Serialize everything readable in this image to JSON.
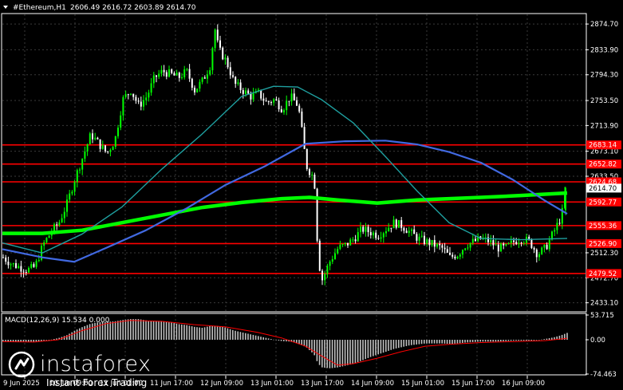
{
  "header": {
    "symbol": "#Ethereum,H1",
    "ohlc": "2606.49 2616.72 2603.89 2614.70"
  },
  "macd": {
    "label": "MACD(12,26,9) 15.534 0.000"
  },
  "branding": {
    "logo_name": "instaforex",
    "tagline": "Instant Forex Trading"
  },
  "colors": {
    "background": "#000000",
    "bull": "#00ff00",
    "bear": "#ffffff",
    "ma_slow": "#00ff00",
    "ma_mid": "#4169e1",
    "ma_fast": "#1fa0a0",
    "level": "#ff0000",
    "macd_signal": "#ff0000",
    "macd_hist": "#c0c0c0"
  },
  "chart_data": [
    {
      "type": "candlestick",
      "title": "#Ethereum,H1",
      "ylim": [
        2420,
        2890
      ],
      "price_ticks": [
        2874.7,
        2833.9,
        2794.3,
        2753.5,
        2713.9,
        2673.1,
        2633.5,
        2512.3,
        2472.7,
        2433.1
      ],
      "current_price": 2614.7,
      "x_labels": [
        "9 Jun 2025",
        "10 Jun 09:00",
        "11 Jun 01:00",
        "11 Jun 17:00",
        "12 Jun 09:00",
        "13 Jun 01:00",
        "13 Jun 17:00",
        "14 Jun 09:00",
        "15 Jun 01:00",
        "15 Jun 17:00",
        "16 Jun 09:00"
      ],
      "levels": [
        {
          "value": 2683.14,
          "label": "2683.14"
        },
        {
          "value": 2652.82,
          "label": "2652.82"
        },
        {
          "value": 2624.68,
          "label": "2624.68"
        },
        {
          "value": 2592.77,
          "label": "2592.77"
        },
        {
          "value": 2555.36,
          "label": "2555.36"
        },
        {
          "value": 2526.9,
          "label": "2526.90"
        },
        {
          "value": 2479.52,
          "label": "2479.52"
        }
      ],
      "close_path": [
        [
          0,
          2505
        ],
        [
          10,
          2495
        ],
        [
          20,
          2490
        ],
        [
          30,
          2485
        ],
        [
          40,
          2490
        ],
        [
          50,
          2525
        ],
        [
          60,
          2545
        ],
        [
          70,
          2560
        ],
        [
          80,
          2590
        ],
        [
          90,
          2630
        ],
        [
          100,
          2665
        ],
        [
          110,
          2700
        ],
        [
          120,
          2685
        ],
        [
          130,
          2670
        ],
        [
          140,
          2690
        ],
        [
          150,
          2755
        ],
        [
          160,
          2770
        ],
        [
          170,
          2745
        ],
        [
          180,
          2760
        ],
        [
          190,
          2790
        ],
        [
          200,
          2800
        ],
        [
          210,
          2795
        ],
        [
          220,
          2790
        ],
        [
          230,
          2800
        ],
        [
          240,
          2770
        ],
        [
          250,
          2785
        ],
        [
          260,
          2810
        ],
        [
          265,
          2870
        ],
        [
          270,
          2835
        ],
        [
          280,
          2815
        ],
        [
          290,
          2780
        ],
        [
          300,
          2770
        ],
        [
          310,
          2760
        ],
        [
          320,
          2765
        ],
        [
          330,
          2750
        ],
        [
          340,
          2755
        ],
        [
          350,
          2740
        ],
        [
          360,
          2760
        ],
        [
          370,
          2745
        ],
        [
          375,
          2700
        ],
        [
          380,
          2650
        ],
        [
          390,
          2630
        ],
        [
          395,
          2500
        ],
        [
          400,
          2470
        ],
        [
          410,
          2500
        ],
        [
          420,
          2520
        ],
        [
          430,
          2525
        ],
        [
          440,
          2535
        ],
        [
          450,
          2550
        ],
        [
          460,
          2545
        ],
        [
          470,
          2540
        ],
        [
          480,
          2550
        ],
        [
          490,
          2560
        ],
        [
          500,
          2555
        ],
        [
          510,
          2545
        ],
        [
          520,
          2535
        ],
        [
          530,
          2530
        ],
        [
          540,
          2525
        ],
        [
          550,
          2520
        ],
        [
          560,
          2505
        ],
        [
          570,
          2510
        ],
        [
          580,
          2525
        ],
        [
          590,
          2530
        ],
        [
          600,
          2535
        ],
        [
          610,
          2530
        ],
        [
          620,
          2520
        ],
        [
          630,
          2520
        ],
        [
          640,
          2530
        ],
        [
          650,
          2535
        ],
        [
          660,
          2530
        ],
        [
          670,
          2510
        ],
        [
          680,
          2520
        ],
        [
          690,
          2545
        ],
        [
          700,
          2570
        ],
        [
          705,
          2614.7
        ]
      ],
      "series": [
        {
          "style": "slow",
          "values": [
            [
              0,
              2543
            ],
            [
              50,
              2543
            ],
            [
              100,
              2548
            ],
            [
              150,
              2560
            ],
            [
              200,
              2572
            ],
            [
              250,
              2584
            ],
            [
              300,
              2592
            ],
            [
              350,
              2598
            ],
            [
              385,
              2600
            ],
            [
              420,
              2596
            ],
            [
              470,
              2591
            ],
            [
              520,
              2596
            ],
            [
              560,
              2598
            ],
            [
              600,
              2600
            ],
            [
              650,
              2603
            ],
            [
              708,
              2607
            ]
          ]
        },
        {
          "style": "mid",
          "values": [
            [
              0,
              2518
            ],
            [
              50,
              2505
            ],
            [
              90,
              2498
            ],
            [
              130,
              2520
            ],
            [
              180,
              2548
            ],
            [
              230,
              2582
            ],
            [
              280,
              2620
            ],
            [
              330,
              2650
            ],
            [
              380,
              2685
            ],
            [
              430,
              2689
            ],
            [
              480,
              2690
            ],
            [
              520,
              2684
            ],
            [
              560,
              2672
            ],
            [
              600,
              2655
            ],
            [
              640,
              2628
            ],
            [
              680,
              2595
            ],
            [
              708,
              2574
            ]
          ]
        },
        {
          "style": "fast",
          "values": [
            [
              0,
              2528
            ],
            [
              50,
              2512
            ],
            [
              100,
              2542
            ],
            [
              150,
              2585
            ],
            [
              200,
              2645
            ],
            [
              250,
              2700
            ],
            [
              300,
              2760
            ],
            [
              340,
              2776
            ],
            [
              370,
              2775
            ],
            [
              400,
              2755
            ],
            [
              440,
              2718
            ],
            [
              480,
              2665
            ],
            [
              520,
              2610
            ],
            [
              560,
              2560
            ],
            [
              600,
              2535
            ],
            [
              650,
              2533
            ],
            [
              708,
              2535
            ]
          ]
        }
      ]
    },
    {
      "type": "bar",
      "title": "MACD(12,26,9) 15.534 0.000",
      "ylim": [
        -74.463,
        53.715
      ],
      "y_ticks": [
        53.715,
        0.0,
        -74.463
      ],
      "histogram": [
        [
          0,
          -3
        ],
        [
          10,
          -4
        ],
        [
          20,
          -5
        ],
        [
          30,
          -5
        ],
        [
          40,
          -5
        ],
        [
          50,
          -2
        ],
        [
          60,
          0
        ],
        [
          70,
          4
        ],
        [
          80,
          10
        ],
        [
          90,
          20
        ],
        [
          100,
          28
        ],
        [
          110,
          35
        ],
        [
          120,
          38
        ],
        [
          130,
          39
        ],
        [
          140,
          40
        ],
        [
          150,
          43
        ],
        [
          160,
          45
        ],
        [
          170,
          45
        ],
        [
          180,
          42
        ],
        [
          190,
          40
        ],
        [
          200,
          40
        ],
        [
          210,
          38
        ],
        [
          220,
          34
        ],
        [
          230,
          32
        ],
        [
          240,
          28
        ],
        [
          250,
          26
        ],
        [
          260,
          30
        ],
        [
          270,
          30
        ],
        [
          280,
          26
        ],
        [
          290,
          20
        ],
        [
          300,
          16
        ],
        [
          310,
          12
        ],
        [
          320,
          8
        ],
        [
          330,
          4
        ],
        [
          340,
          0
        ],
        [
          350,
          -3
        ],
        [
          360,
          -4
        ],
        [
          370,
          -8
        ],
        [
          380,
          -16
        ],
        [
          390,
          -32
        ],
        [
          395,
          -52
        ],
        [
          400,
          -60
        ],
        [
          410,
          -62
        ],
        [
          420,
          -60
        ],
        [
          430,
          -56
        ],
        [
          440,
          -52
        ],
        [
          450,
          -45
        ],
        [
          460,
          -38
        ],
        [
          470,
          -32
        ],
        [
          480,
          -26
        ],
        [
          490,
          -20
        ],
        [
          500,
          -16
        ],
        [
          510,
          -12
        ],
        [
          520,
          -10
        ],
        [
          530,
          -8
        ],
        [
          540,
          -8
        ],
        [
          550,
          -8
        ],
        [
          560,
          -9
        ],
        [
          570,
          -8
        ],
        [
          580,
          -6
        ],
        [
          590,
          -5
        ],
        [
          600,
          -4
        ],
        [
          610,
          -4
        ],
        [
          620,
          -4
        ],
        [
          630,
          -3
        ],
        [
          640,
          -2
        ],
        [
          650,
          -2
        ],
        [
          660,
          -2
        ],
        [
          670,
          -1
        ],
        [
          680,
          2
        ],
        [
          690,
          5
        ],
        [
          700,
          10
        ],
        [
          708,
          15.534
        ]
      ],
      "signal": [
        [
          0,
          -4
        ],
        [
          40,
          -5
        ],
        [
          70,
          0
        ],
        [
          100,
          20
        ],
        [
          130,
          35
        ],
        [
          160,
          42
        ],
        [
          200,
          40
        ],
        [
          240,
          33
        ],
        [
          280,
          28
        ],
        [
          320,
          16
        ],
        [
          350,
          4
        ],
        [
          380,
          -14
        ],
        [
          400,
          -35
        ],
        [
          420,
          -55
        ],
        [
          440,
          -52
        ],
        [
          470,
          -40
        ],
        [
          500,
          -26
        ],
        [
          530,
          -14
        ],
        [
          560,
          -10
        ],
        [
          600,
          -6
        ],
        [
          640,
          -4
        ],
        [
          680,
          -2
        ],
        [
          708,
          3
        ]
      ]
    }
  ]
}
